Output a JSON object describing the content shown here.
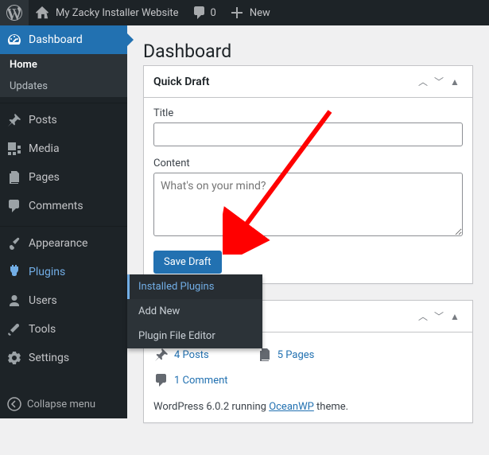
{
  "adminbar": {
    "site_name": "My Zacky Installer Website",
    "comments_count": "0",
    "new_label": "New"
  },
  "sidebar": {
    "dashboard": "Dashboard",
    "home": "Home",
    "updates": "Updates",
    "posts": "Posts",
    "media": "Media",
    "pages": "Pages",
    "comments": "Comments",
    "appearance": "Appearance",
    "plugins": "Plugins",
    "users": "Users",
    "tools": "Tools",
    "settings": "Settings",
    "collapse": "Collapse menu"
  },
  "flyout": {
    "installed": "Installed Plugins",
    "add_new": "Add New",
    "editor": "Plugin File Editor"
  },
  "page": {
    "title": "Dashboard"
  },
  "quick_draft": {
    "heading": "Quick Draft",
    "title_label": "Title",
    "content_label": "Content",
    "content_placeholder": "What's on your mind?",
    "save_label": "Save Draft"
  },
  "glance": {
    "posts": "4 Posts",
    "pages": "5 Pages",
    "comments": "1 Comment",
    "version_prefix": "WordPress 6.0.2 running ",
    "theme": "OceanWP",
    "version_suffix": " theme."
  }
}
